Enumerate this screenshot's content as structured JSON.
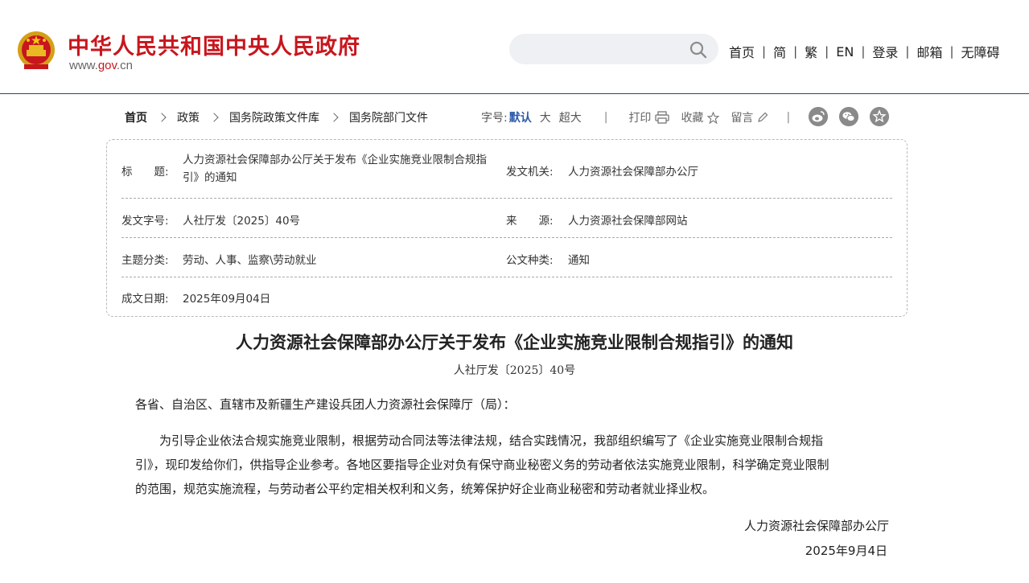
{
  "header": {
    "title": "中华人民共和国中央人民政府",
    "url_prefix": "www.",
    "url_mid": "gov",
    "url_suffix": ".cn",
    "search_placeholder": "",
    "nav": [
      "首页",
      "简",
      "繁",
      "EN",
      "登录",
      "邮箱",
      "无障碍"
    ],
    "nav_sep": "|"
  },
  "breadcrumb": {
    "items": [
      "首页",
      "政策",
      "国务院政策文件库",
      "国务院部门文件"
    ]
  },
  "tools": {
    "font_label": "字号:",
    "font_default": "默认",
    "font_large": "大",
    "font_xlarge": "超大",
    "sep": "|",
    "print": "打印",
    "favorite": "收藏",
    "comment": "留言"
  },
  "info": {
    "title_label": "标　　题:",
    "title_value_line1": "人力资源社会保障部办公厅关于发布《企业实施竞业限制合规指",
    "title_value_line2": "引》的通知",
    "issuer_label": "发文机关:",
    "issuer_value": "人力资源社会保障部办公厅",
    "docno_label": "发文字号:",
    "docno_value": "人社厅发〔2025〕40号",
    "source_label": "来　　源:",
    "source_value": "人力资源社会保障部网站",
    "topic_label": "主题分类:",
    "topic_value": "劳动、人事、监察\\劳动就业",
    "type_label": "公文种类:",
    "type_value": "通知",
    "date_label": "成文日期:",
    "date_value": "2025年09月04日"
  },
  "article": {
    "title": "人力资源社会保障部办公厅关于发布《企业实施竞业限制合规指引》的通知",
    "doc_number": "人社厅发〔2025〕40号",
    "salutation": "各省、自治区、直辖市及新疆生产建设兵团人力资源社会保障厅（局）：",
    "body_line1": "　　为引导企业依法合规实施竞业限制，根据劳动合同法等法律法规，结合实践情况，我部组织编写了《企业实施竞业限制合规指",
    "body_line2": "引》，现印发给你们，供指导企业参考。各地区要指导企业对负有保守商业秘密义务的劳动者依法实施竞业限制，科学确定竞业限制",
    "body_line3": "的范围，规范实施流程，与劳动者公平约定相关权利和义务，统筹保护好企业商业秘密和劳动者就业择业权。",
    "signature": "人力资源社会保障部办公厅",
    "sign_date": "2025年9月4日"
  },
  "colors": {
    "brand_red": "#c8161d",
    "link_blue": "#2d5aa8",
    "search_bg": "#eef0f3"
  },
  "icons": [
    "national-emblem-icon",
    "search-icon",
    "print-icon",
    "star-icon",
    "pencil-icon",
    "weibo-icon",
    "wechat-icon",
    "favorite-share-icon"
  ]
}
